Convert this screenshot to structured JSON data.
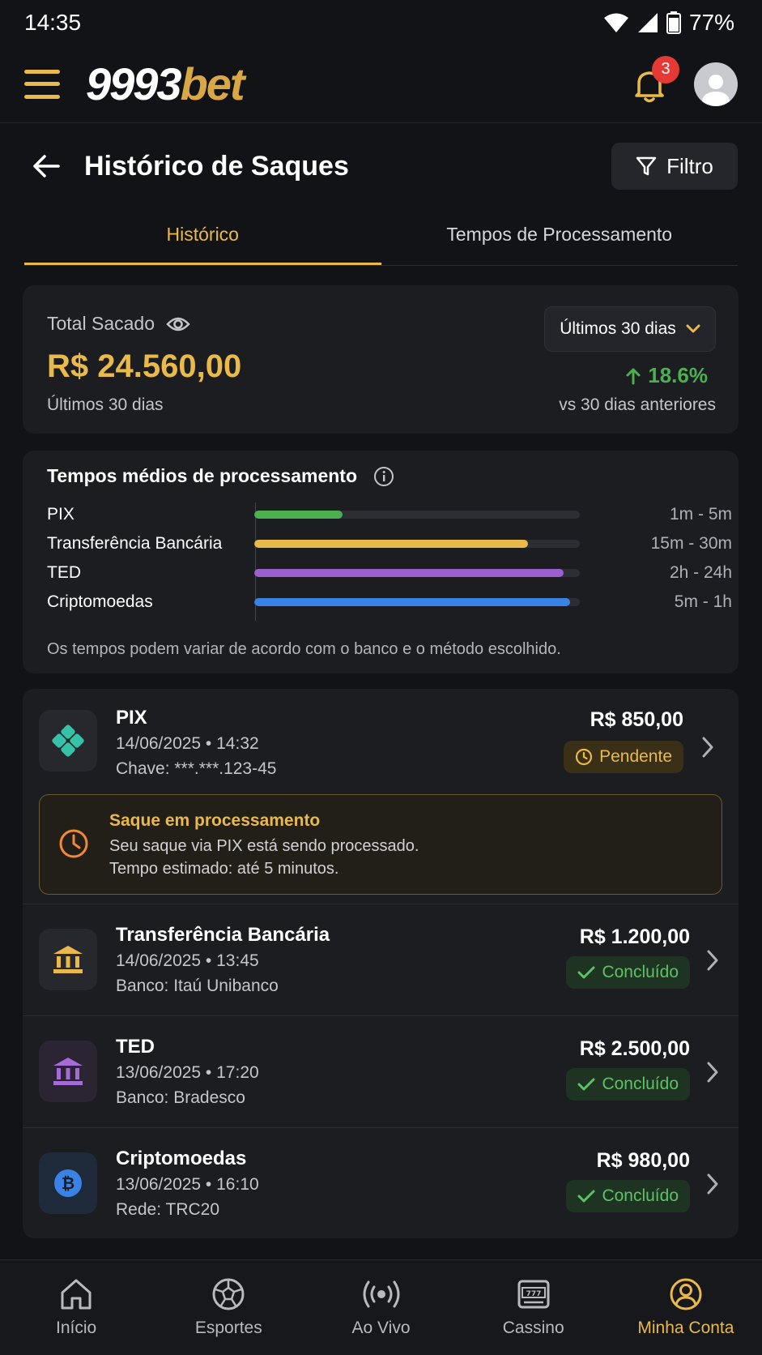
{
  "statusbar": {
    "time": "14:35",
    "battery": "77%"
  },
  "header": {
    "logo_main": "9993",
    "logo_accent": "bet",
    "notifications_count": "3"
  },
  "page": {
    "title": "Histórico de Saques",
    "filter_label": "Filtro"
  },
  "tabs": [
    {
      "label": "Histórico",
      "active": true
    },
    {
      "label": "Tempos de Processamento",
      "active": false
    }
  ],
  "summary": {
    "label": "Total Sacado",
    "amount": "R$ 24.560,00",
    "period": "Últimos 30 dias",
    "select_value": "Últimos 30 dias",
    "change": "18.6%",
    "compare_label": "vs 30 dias anteriores"
  },
  "processing": {
    "heading": "Tempos médios de processamento",
    "methods": [
      {
        "name": "PIX",
        "range": "1m - 5m",
        "level": 0.27,
        "color": "#4caf50"
      },
      {
        "name": "Transferência Bancária",
        "range": "15m - 30m",
        "level": 0.84,
        "color": "#e9b949"
      },
      {
        "name": "TED",
        "range": "2h - 24h",
        "level": 0.95,
        "color": "#9c5fd0"
      },
      {
        "name": "Criptomoedas",
        "range": "5m - 1h",
        "level": 0.97,
        "color": "#3b82e6"
      }
    ],
    "note": "Os tempos podem variar de acordo com o banco e o método escolhido."
  },
  "withdrawals": [
    {
      "title": "PIX",
      "datetime": "14/06/2025 • 14:32",
      "detail": "Chave: ***.***.123-45",
      "amount": "R$ 850,00",
      "status": "Pendente",
      "icon": "pix-icon",
      "alert": {
        "title": "Saque em processamento",
        "line1": "Seu saque via PIX está sendo processado.",
        "line2": "Tempo estimado: até 5 minutos."
      }
    },
    {
      "title": "Transferência Bancária",
      "datetime": "14/06/2025 • 13:45",
      "detail": "Banco: Itaú Unibanco",
      "amount": "R$ 1.200,00",
      "status": "Concluído",
      "icon": "bank-icon"
    },
    {
      "title": "TED",
      "datetime": "13/06/2025 • 17:20",
      "detail": "Banco: Bradesco",
      "amount": "R$ 2.500,00",
      "status": "Concluído",
      "icon": "bank-icon"
    },
    {
      "title": "Criptomoedas",
      "datetime": "13/06/2025 • 16:10",
      "detail": "Rede: TRC20",
      "amount": "R$ 980,00",
      "status": "Concluído",
      "icon": "bitcoin-icon"
    }
  ],
  "bottom_nav": [
    {
      "label": "Início",
      "icon": "home-icon"
    },
    {
      "label": "Esportes",
      "icon": "soccer-ball-icon"
    },
    {
      "label": "Ao Vivo",
      "icon": "live-broadcast-icon"
    },
    {
      "label": "Cassino",
      "icon": "slot-machine-icon"
    },
    {
      "label": "Minha Conta",
      "icon": "account-icon",
      "active": true
    }
  ],
  "colors": {
    "accent": "#e9b949",
    "success": "#5cc365",
    "background": "#121316",
    "card": "#1c1d21"
  }
}
